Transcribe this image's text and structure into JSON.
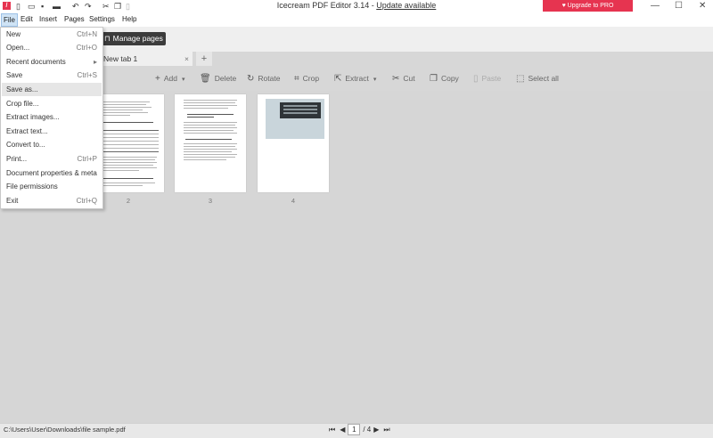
{
  "app": {
    "title": "Icecream PDF Editor 3.14 - ",
    "update_link": "Update available",
    "upgrade_label": "Upgrade to PRO",
    "brand_color": "#e63450"
  },
  "menubar": {
    "items": [
      "File",
      "Edit",
      "Insert",
      "Pages",
      "Settings",
      "Help"
    ]
  },
  "window_controls": {
    "minimize": "—",
    "maximize": "☐",
    "close": "✕"
  },
  "pages_bar": {
    "manage_label": "Manage pages"
  },
  "tabs": {
    "active_label": "New tab 1",
    "close_glyph": "×",
    "add_glyph": "+"
  },
  "toolbar": {
    "add": "Add",
    "delete": "Delete",
    "rotate": "Rotate",
    "crop": "Crop",
    "extract": "Extract",
    "cut": "Cut",
    "copy": "Copy",
    "paste": "Paste",
    "select_all": "Select all"
  },
  "file_menu": {
    "items": [
      {
        "label": "New",
        "shortcut": "Ctrl+N"
      },
      {
        "label": "Open...",
        "shortcut": "Ctrl+O"
      },
      {
        "label": "Recent documents",
        "shortcut": "▸"
      },
      {
        "label": "Save",
        "shortcut": "Ctrl+S"
      },
      {
        "label": "Save as...",
        "shortcut": ""
      },
      {
        "label": "Crop file...",
        "shortcut": ""
      },
      {
        "label": "Extract images...",
        "shortcut": ""
      },
      {
        "label": "Extract text...",
        "shortcut": ""
      },
      {
        "label": "Convert to...",
        "shortcut": ""
      },
      {
        "label": "Print...",
        "shortcut": "Ctrl+P"
      },
      {
        "label": "Document properties & meta",
        "shortcut": ""
      },
      {
        "label": "File permissions",
        "shortcut": ""
      },
      {
        "label": "Exit",
        "shortcut": "Ctrl+Q"
      }
    ]
  },
  "pages": {
    "numbers": [
      "2",
      "3",
      "4"
    ],
    "page2_heading": "Lorem dolor sit amet, nisi cursus sed adipiscing elit"
  },
  "statusbar": {
    "file_path": "C:\\Users\\User\\Downloads\\file sample.pdf",
    "current_page": "1",
    "total_pages": "/ 4"
  }
}
